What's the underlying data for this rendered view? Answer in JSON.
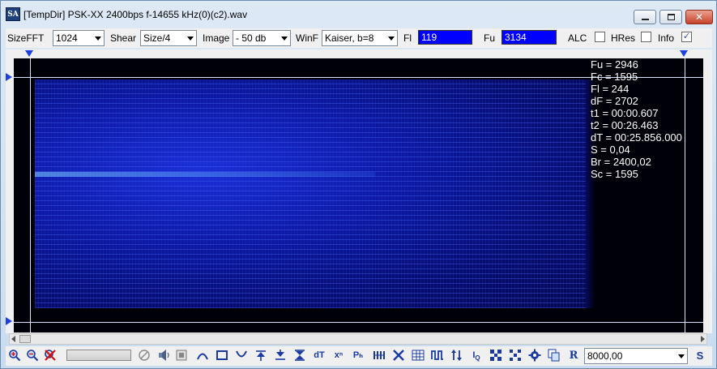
{
  "window": {
    "icon_text": "SA",
    "title": "[TempDir] PSK-XX 2400bps f-14655 kHz(0)(c2).wav",
    "minimize": "_",
    "maximize": "□",
    "close": "✕"
  },
  "toolbar": {
    "sizefft_label": "SizeFFT",
    "sizefft_value": "1024",
    "shear_label": "Shear",
    "shear_value": "Size/4",
    "image_label": "Image",
    "image_value": "- 50 db",
    "winf_label": "WinF",
    "winf_value": "Kaiser, b=8",
    "fl_label": "Fl",
    "fl_value": "119",
    "fu_label": "Fu",
    "fu_value": "3134",
    "alc_label": "ALC",
    "alc_checked": false,
    "hres_label": "HRes",
    "hres_checked": false,
    "info_label": "Info",
    "info_checked": true,
    "check_mark": "✓"
  },
  "info_panel": [
    "Fu = 2946",
    "Fc = 1595",
    "Fl = 244",
    "dF = 2702",
    "t1 = 00:00.607",
    "t2 = 00:26.463",
    "dT = 00:25.856.000",
    "S = 0,04",
    "Br = 2400,02",
    "Sc = 1595"
  ],
  "bottombar": {
    "icons": [
      "zoom-in-icon",
      "zoom-out-icon",
      "cancel-icon",
      "progress-bar",
      "circle-slash-icon",
      "speaker-icon",
      "stop-square-icon",
      "arc-up-icon",
      "rect-icon",
      "arc-down-icon",
      "marker-up-icon",
      "marker-down-icon",
      "marker-both-icon",
      "dT",
      "x_n",
      "P_h",
      "bars-icon",
      "cross-icon",
      "grid-icon",
      "wave-icon",
      "updown-icon",
      "IQ",
      "pattern-a-icon",
      "pattern-b-icon",
      "gear-icon",
      "copy-icon",
      "R"
    ],
    "glyph_dT": "dT",
    "glyph_xn": "xⁿ",
    "glyph_ph": "Pₕ",
    "glyph_iq": "I",
    "glyph_iq_sub": "Q",
    "glyph_r": "R",
    "zoom_value": "8000,00",
    "s_button": "S"
  },
  "colors": {
    "accent": "#1f3fe0",
    "spectrum_blue": "#1a2fd8",
    "field_blue": "#0000ff"
  }
}
